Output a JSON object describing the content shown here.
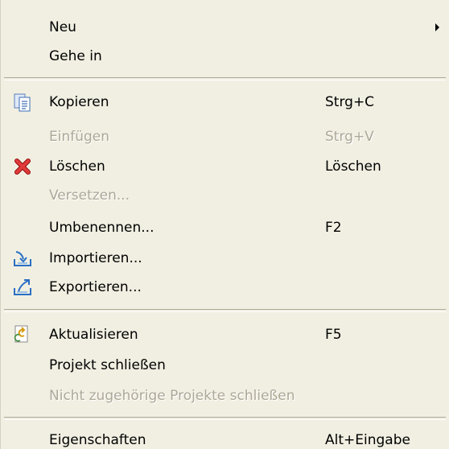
{
  "menu": {
    "items": [
      {
        "label": "Neu",
        "shortcut": "",
        "disabled": false,
        "icon": "",
        "submenu": true
      },
      {
        "label": "Gehe in",
        "shortcut": "",
        "disabled": false,
        "icon": "",
        "submenu": false
      },
      {
        "label": "Kopieren",
        "shortcut": "Strg+C",
        "disabled": false,
        "icon": "copy-icon",
        "submenu": false
      },
      {
        "label": "Einfügen",
        "shortcut": "Strg+V",
        "disabled": true,
        "icon": "",
        "submenu": false
      },
      {
        "label": "Löschen",
        "shortcut": "Löschen",
        "disabled": false,
        "icon": "delete-icon",
        "submenu": false
      },
      {
        "label": "Versetzen...",
        "shortcut": "",
        "disabled": true,
        "icon": "",
        "submenu": false
      },
      {
        "label": "Umbenennen...",
        "shortcut": "F2",
        "disabled": false,
        "icon": "",
        "submenu": false
      },
      {
        "label": "Importieren...",
        "shortcut": "",
        "disabled": false,
        "icon": "import-icon",
        "submenu": false
      },
      {
        "label": "Exportieren...",
        "shortcut": "",
        "disabled": false,
        "icon": "export-icon",
        "submenu": false
      },
      {
        "label": "Aktualisieren",
        "shortcut": "F5",
        "disabled": false,
        "icon": "refresh-icon",
        "submenu": false
      },
      {
        "label": "Projekt schließen",
        "shortcut": "",
        "disabled": false,
        "icon": "",
        "submenu": false
      },
      {
        "label": "Nicht zugehörige Projekte schließen",
        "shortcut": "",
        "disabled": true,
        "icon": "",
        "submenu": false
      },
      {
        "label": "Eigenschaften",
        "shortcut": "Alt+Eingabe",
        "disabled": false,
        "icon": "",
        "submenu": false
      }
    ]
  },
  "colors": {
    "menu_background": "#f1efe2",
    "disabled_text": "#aca899",
    "separator": "#aca899"
  }
}
